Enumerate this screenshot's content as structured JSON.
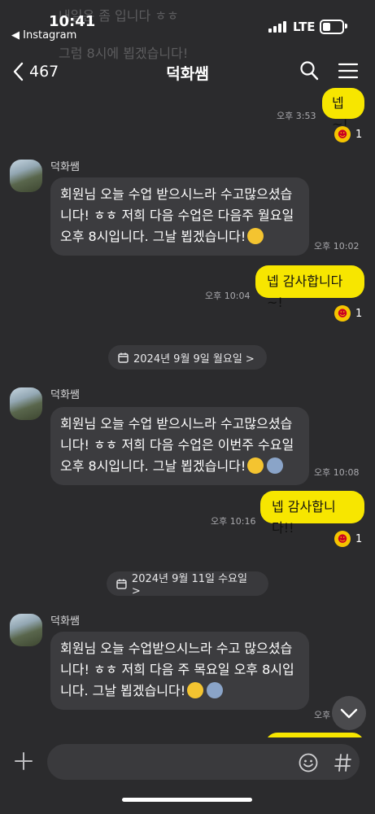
{
  "ghost": {
    "line1": "내일은 좀 입니다 ㅎㅎ",
    "line2": "그럼 8시에 뵙겠습니다!"
  },
  "status_bar": {
    "time": "10:41",
    "back_app": "◀ Instagram",
    "network": "LTE"
  },
  "header": {
    "back_count": "467",
    "title": "덕화쌤"
  },
  "messages": [
    {
      "type": "me",
      "text": "넵~!",
      "time": "오후 3:53",
      "reaction_count": "1"
    },
    {
      "type": "other",
      "sender": "덕화쌤",
      "text": "회원님 오늘 수업 받으시느라 수고많으셨습니다! ㅎㅎ 저희 다음 수업은 다음주 월요일 오후 8시입니다. 그날 뵙겠습니다!",
      "time": "오후 10:02"
    },
    {
      "type": "me",
      "text": "넵 감사합니다~!",
      "time": "오후 10:04",
      "reaction_count": "1"
    },
    {
      "type": "date",
      "text": "2024년 9월 9일 월요일 >"
    },
    {
      "type": "other",
      "sender": "덕화쌤",
      "text": "회원님 오늘 수업 받으시느라 수고많으셨습니다! ㅎㅎ 저희 다음 수업은 이번주 수요일 오후 8시입니다. 그날 뵙겠습니다!",
      "time": "오후 10:08"
    },
    {
      "type": "me",
      "text": "넵 감사합니다!!",
      "time": "오후 10:16",
      "reaction_count": "1"
    },
    {
      "type": "date",
      "text": "2024년 9월 11일 수요일 >"
    },
    {
      "type": "other",
      "sender": "덕화쌤",
      "text": "회원님 오늘 수업받으시느라 수고 많으셨습니다! ㅎㅎ 저희 다음 주 목요일 오후 8시입니다. 그날 뵙겠습니다!",
      "time": "오후"
    }
  ],
  "icons": {
    "back": "chevron-left-icon",
    "search": "search-icon",
    "menu": "menu-icon",
    "calendar": "calendar-icon",
    "scroll_down": "chevron-down-icon",
    "plus": "plus-icon",
    "emoji": "emoji-icon",
    "hash": "hash-icon"
  },
  "colors": {
    "background": "#2b2b2d",
    "my_bubble": "#f7e600",
    "other_bubble": "#3c3c3f"
  }
}
